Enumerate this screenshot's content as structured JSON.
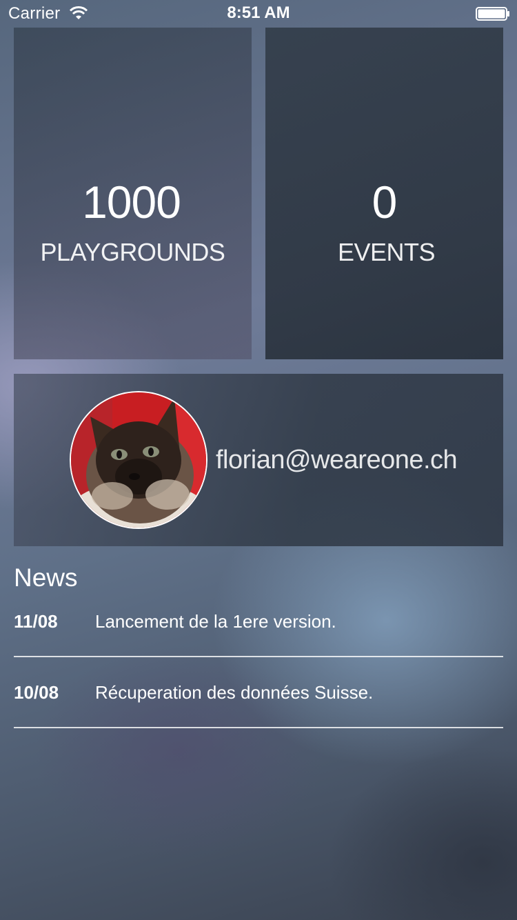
{
  "status_bar": {
    "carrier": "Carrier",
    "time": "8:51 AM",
    "wifi_icon": "wifi-icon",
    "battery_icon": "battery-icon"
  },
  "stats": {
    "playgrounds": {
      "value": "1000",
      "label": "PLAYGROUNDS"
    },
    "events": {
      "value": "0",
      "label": "EVENTS"
    }
  },
  "profile": {
    "email": "florian@weareone.ch",
    "avatar_icon": "cat-avatar"
  },
  "news": {
    "title": "News",
    "items": [
      {
        "date": "11/08",
        "text": "Lancement de la 1ere version."
      },
      {
        "date": "10/08",
        "text": "Récuperation des données Suisse."
      }
    ]
  },
  "colors": {
    "text": "#ffffff",
    "tile_dark": "#303a48",
    "divider": "#ffffff"
  }
}
